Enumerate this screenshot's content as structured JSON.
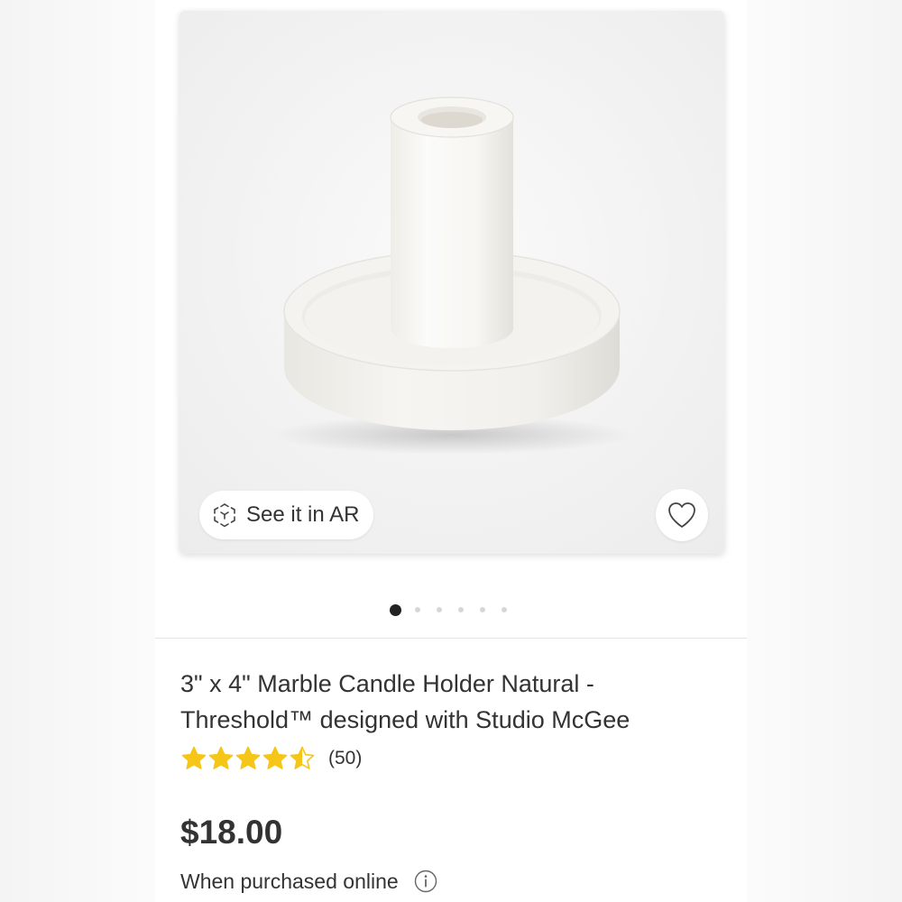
{
  "gallery": {
    "image_alt": "White marble candle holder",
    "ar_button_label": "See it in AR",
    "ar_icon": "ar-cube-icon",
    "favorite_icon": "heart-outline-icon",
    "slide_count": 6,
    "active_slide": 1
  },
  "product": {
    "title": "3\" x 4\" Marble Candle Holder Natural - Threshold™ designed with Studio McGee",
    "rating": 4.5,
    "rating_max": 5,
    "review_count": "(50)",
    "price": "$18.00",
    "purchase_note": "When purchased online",
    "info_icon": "info-circle-icon"
  },
  "colors": {
    "star": "#F5C518",
    "text": "#333333",
    "active_dot": "#222222",
    "inactive_dot": "#d6d6d6"
  }
}
